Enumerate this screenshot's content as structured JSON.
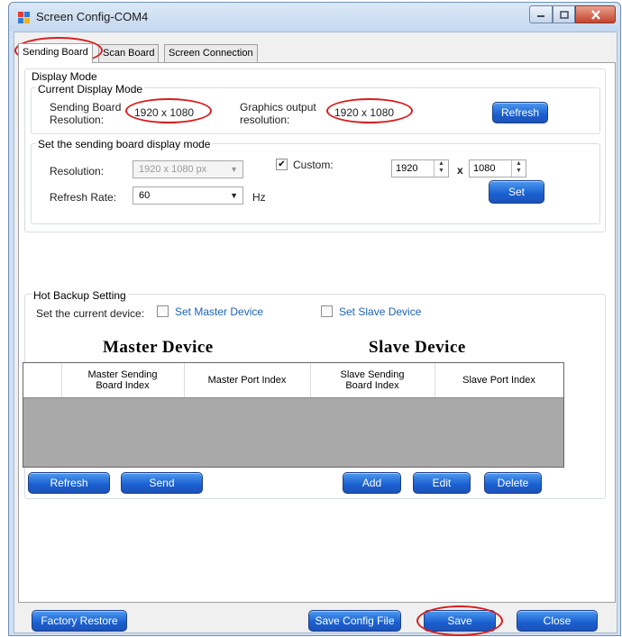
{
  "window": {
    "title": "Screen Config-COM4",
    "icon": "app-window-icon",
    "controls": [
      "minimize-icon",
      "maximize-icon",
      "close-icon"
    ]
  },
  "tabs": [
    {
      "label": "Sending Board",
      "active": true
    },
    {
      "label": "Scan Board",
      "active": false
    },
    {
      "label": "Screen Connection",
      "active": false
    }
  ],
  "display_mode": {
    "group_label": "Display Mode",
    "current": {
      "group_label": "Current Display Mode",
      "sending_label_1": "Sending Board",
      "sending_label_2": "Resolution:",
      "sending_value": "1920 x 1080",
      "graphics_label_1": "Graphics output",
      "graphics_label_2": "resolution:",
      "graphics_value": "1920 x 1080",
      "refresh_button": "Refresh"
    },
    "set_mode": {
      "group_label": "Set the sending board display mode",
      "resolution_label": "Resolution:",
      "resolution_value": "1920 x 1080 px",
      "refresh_rate_label": "Refresh Rate:",
      "refresh_rate_value": "60",
      "hz_label": "Hz",
      "custom_label": "Custom:",
      "custom_checked": true,
      "width_value": "1920",
      "x_label": "x",
      "height_value": "1080",
      "set_button": "Set"
    }
  },
  "hot_backup": {
    "group_label": "Hot Backup Setting",
    "current_device_label": "Set the current device:",
    "master_checkbox_label": "Set Master Device",
    "slave_checkbox_label": "Set Slave Device",
    "master_title": "Master Device",
    "slave_title": "Slave Device",
    "columns": [
      {
        "line1": "Master Sending",
        "line2": "Board Index"
      },
      {
        "line1": "Master Port Index",
        "line2": ""
      },
      {
        "line1": "Slave Sending",
        "line2": "Board Index"
      },
      {
        "line1": "Slave Port Index",
        "line2": ""
      }
    ],
    "buttons": {
      "refresh": "Refresh",
      "send": "Send",
      "add": "Add",
      "edit": "Edit",
      "delete": "Delete"
    }
  },
  "footer": {
    "factory_restore": "Factory Restore",
    "save_config_file": "Save Config File",
    "save": "Save",
    "close": "Close"
  },
  "colors": {
    "annotation_ellipse": "#d81e1e",
    "button_blue": "#1a5fd0",
    "label_blue": "#1d63b8"
  }
}
